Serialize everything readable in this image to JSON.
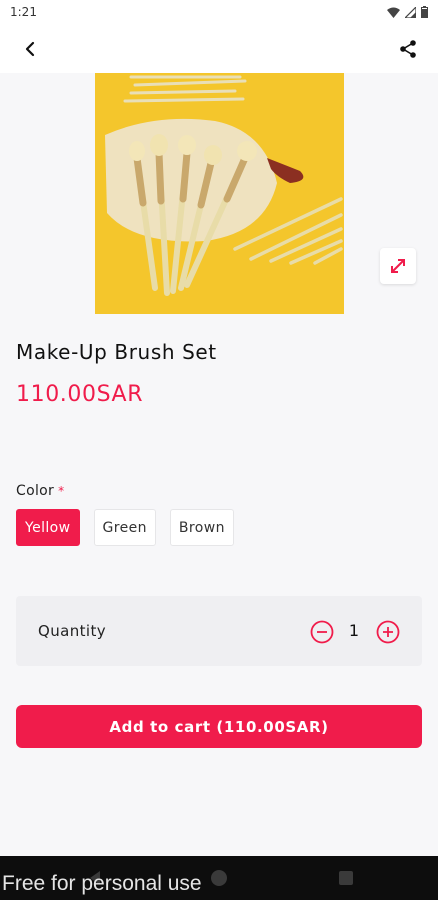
{
  "status_bar": {
    "time": "1:21"
  },
  "header": {
    "back_icon": "arrow-back-icon",
    "share_icon": "share-icon"
  },
  "product": {
    "title": "Make-Up Brush Set",
    "price": "110.00SAR",
    "image_subject": "makeup brush set on yellow background",
    "expand_icon": "expand-icon"
  },
  "color": {
    "label": "Color",
    "required_mark": "*",
    "options": [
      "Yellow",
      "Green",
      "Brown"
    ],
    "selected": "Yellow"
  },
  "quantity": {
    "label": "Quantity",
    "value": "1"
  },
  "cart": {
    "button_label": "Add to cart (110.00SAR)"
  },
  "watermark": "Free for personal use",
  "colors": {
    "accent": "#f01c4b",
    "background": "#f7f7f9",
    "card": "#efeff2",
    "product_bg": "#f4c62c"
  }
}
